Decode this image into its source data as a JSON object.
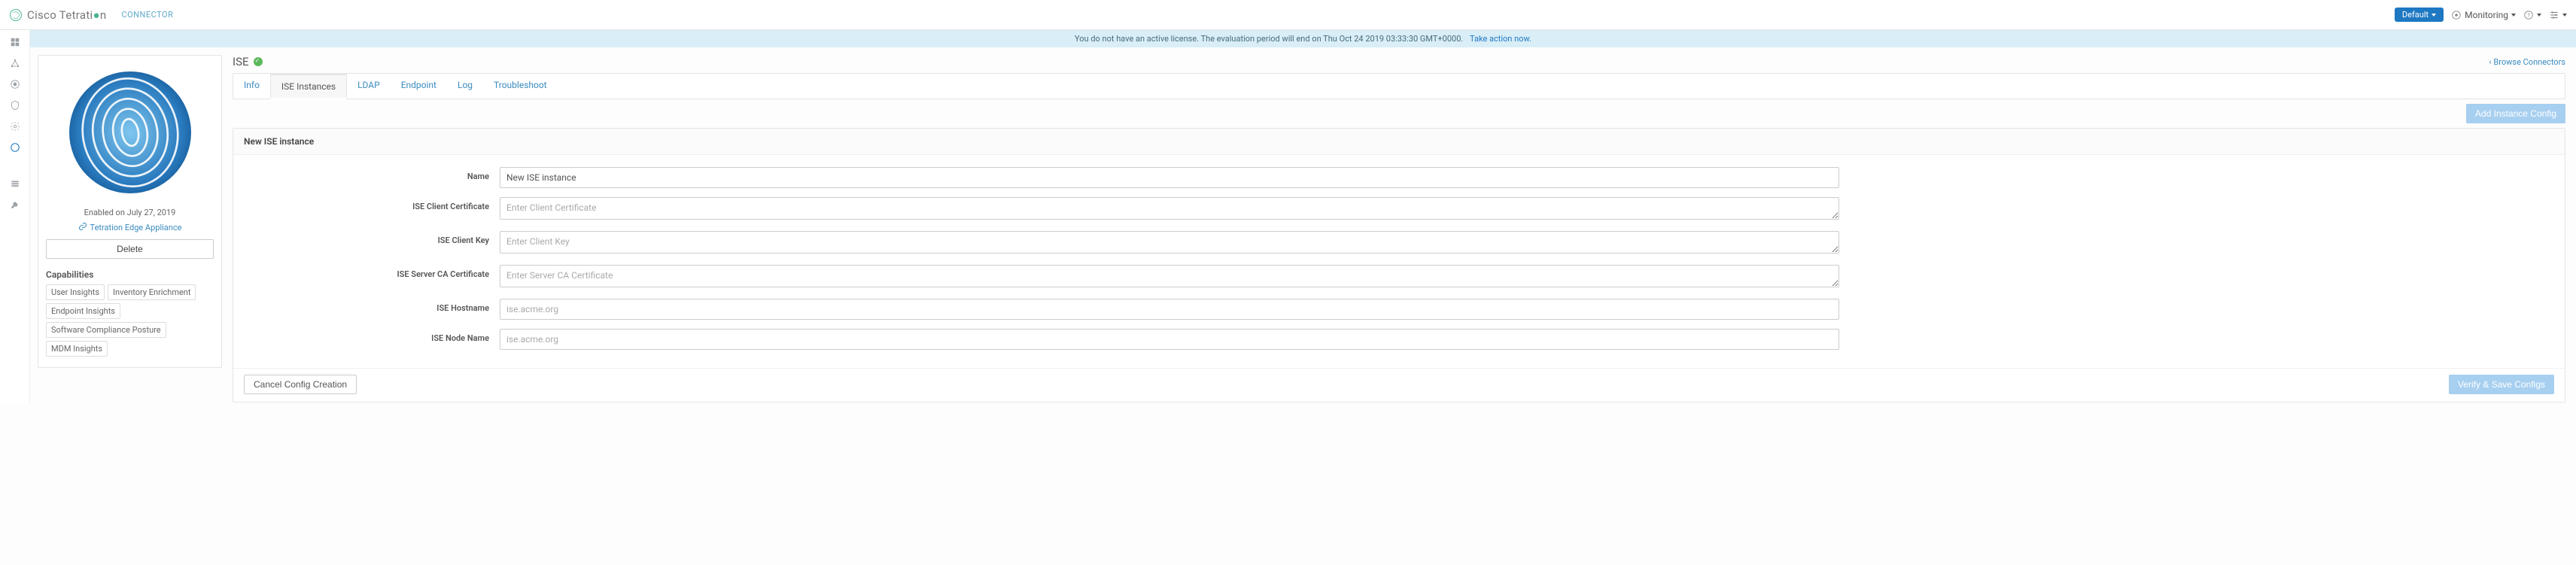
{
  "brand": {
    "pre": "Cisco Tetrati",
    "post": "n"
  },
  "connector_label": "CONNECTOR",
  "header": {
    "scope": "Default",
    "monitoring": "Monitoring"
  },
  "alert": {
    "text": "You do not have an active license. The evaluation period will end on Thu Oct 24 2019 03:33:30 GMT+0000.",
    "action": "Take action now."
  },
  "info": {
    "enabled": "Enabled on July 27, 2019",
    "appliance": "Tetration Edge Appliance",
    "delete": "Delete",
    "caps_title": "Capabilities",
    "caps": [
      "User Insights",
      "Inventory Enrichment",
      "Endpoint Insights",
      "Software Compliance Posture",
      "MDM Insights"
    ]
  },
  "detail": {
    "title": "ISE",
    "browse": "Browse Connectors"
  },
  "tabs": [
    "Info",
    "ISE Instances",
    "LDAP",
    "Endpoint",
    "Log",
    "Troubleshoot"
  ],
  "toolbar": {
    "add_instance": "Add Instance Config"
  },
  "panel": {
    "title": "New ISE instance",
    "cancel": "Cancel Config Creation",
    "verify": "Verify & Save Configs"
  },
  "form": {
    "name": {
      "label": "Name",
      "value": "New ISE instance"
    },
    "client_cert": {
      "label": "ISE Client Certificate",
      "placeholder": "Enter Client Certificate"
    },
    "client_key": {
      "label": "ISE Client Key",
      "placeholder": "Enter Client Key"
    },
    "server_ca": {
      "label": "ISE Server CA Certificate",
      "placeholder": "Enter Server CA Certificate"
    },
    "hostname": {
      "label": "ISE Hostname",
      "placeholder": "ise.acme.org"
    },
    "node_name": {
      "label": "ISE Node Name",
      "placeholder": "ise.acme.org"
    }
  }
}
